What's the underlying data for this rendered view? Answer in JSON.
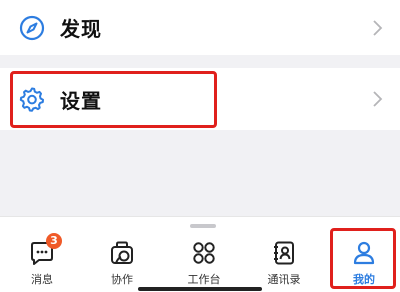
{
  "menu": {
    "discover_label": "发现",
    "settings_label": "设置"
  },
  "tabbar": {
    "tabs": [
      {
        "label": "消息",
        "badge": "3",
        "icon": "chat-icon"
      },
      {
        "label": "协作",
        "icon": "collaboration-icon"
      },
      {
        "label": "工作台",
        "icon": "workbench-grid-icon"
      },
      {
        "label": "通讯录",
        "icon": "contacts-icon"
      },
      {
        "label": "我的",
        "icon": "person-icon",
        "active": true
      }
    ]
  },
  "colors": {
    "accent": "#2d7de0",
    "highlight": "#e0201c",
    "badge": "#f05a28"
  }
}
